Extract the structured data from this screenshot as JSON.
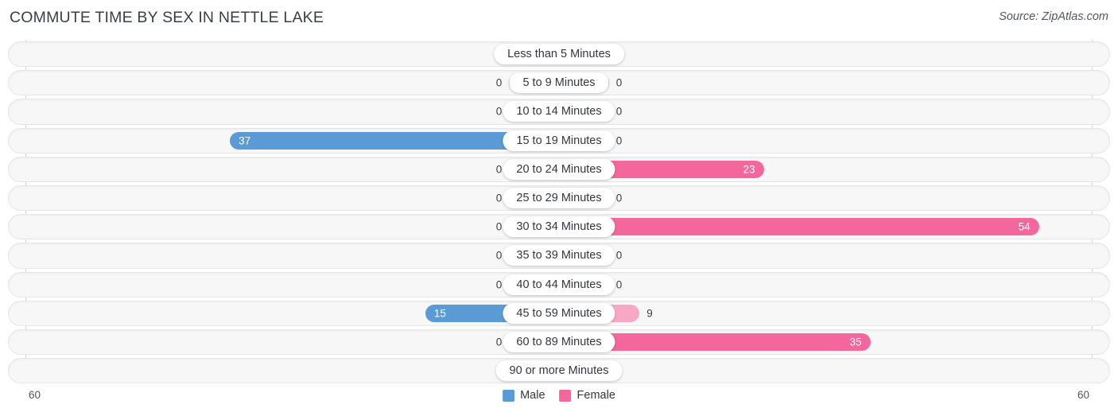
{
  "header": {
    "title": "COMMUTE TIME BY SEX IN NETTLE LAKE",
    "source": "Source: ZipAtlas.com"
  },
  "legend": {
    "items": [
      {
        "label": "Male",
        "color": "#5b9bd5"
      },
      {
        "label": "Female",
        "color": "#f4679d"
      }
    ]
  },
  "axis": {
    "left_label": "60",
    "right_label": "60",
    "max": 60
  },
  "colors": {
    "male_strong": "#5b9bd5",
    "male_light": "#a6c8ec",
    "female_strong": "#f4679d",
    "female_light": "#f8a8c4",
    "track": "#f7f7f7",
    "track_border": "#e6e6e6",
    "axis_line": "#d3d3d3",
    "title": "#3a3f47"
  },
  "chart_data": {
    "type": "bar",
    "title": "COMMUTE TIME BY SEX IN NETTLE LAKE",
    "subtitle": "",
    "xlabel": "",
    "ylabel": "",
    "orientation": "horizontal",
    "layout": "diverging-bidirectional",
    "legend_position": "bottom-center",
    "grid": false,
    "xlim": [
      60,
      60
    ],
    "categories": [
      "Less than 5 Minutes",
      "5 to 9 Minutes",
      "10 to 14 Minutes",
      "15 to 19 Minutes",
      "20 to 24 Minutes",
      "25 to 29 Minutes",
      "30 to 34 Minutes",
      "35 to 39 Minutes",
      "40 to 44 Minutes",
      "45 to 59 Minutes",
      "60 to 89 Minutes",
      "90 or more Minutes"
    ],
    "series": [
      {
        "name": "Male",
        "values": [
          0,
          0,
          0,
          37,
          0,
          0,
          0,
          0,
          0,
          15,
          0,
          0
        ]
      },
      {
        "name": "Female",
        "values": [
          0,
          0,
          0,
          0,
          23,
          0,
          54,
          0,
          0,
          9,
          35,
          0
        ]
      }
    ]
  },
  "rows": [
    {
      "label": "Less than 5 Minutes",
      "male": "0",
      "female": "0"
    },
    {
      "label": "5 to 9 Minutes",
      "male": "0",
      "female": "0"
    },
    {
      "label": "10 to 14 Minutes",
      "male": "0",
      "female": "0"
    },
    {
      "label": "15 to 19 Minutes",
      "male": "37",
      "female": "0"
    },
    {
      "label": "20 to 24 Minutes",
      "male": "0",
      "female": "23"
    },
    {
      "label": "25 to 29 Minutes",
      "male": "0",
      "female": "0"
    },
    {
      "label": "30 to 34 Minutes",
      "male": "0",
      "female": "54"
    },
    {
      "label": "35 to 39 Minutes",
      "male": "0",
      "female": "0"
    },
    {
      "label": "40 to 44 Minutes",
      "male": "0",
      "female": "0"
    },
    {
      "label": "45 to 59 Minutes",
      "male": "15",
      "female": "9"
    },
    {
      "label": "60 to 89 Minutes",
      "male": "0",
      "female": "35"
    },
    {
      "label": "90 or more Minutes",
      "male": "0",
      "female": "0"
    }
  ]
}
